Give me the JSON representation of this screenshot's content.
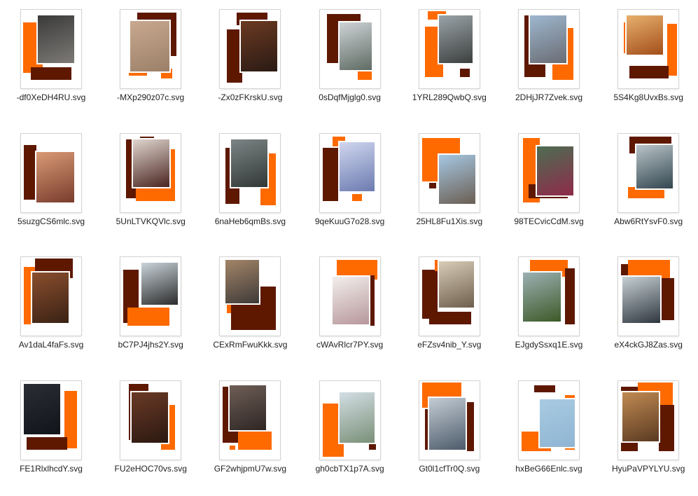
{
  "colors": {
    "orange": "#fe6a00",
    "maroon": "#5e1800",
    "label": "#222222"
  },
  "files": [
    {
      "name": "-df0XeDH4RU.svg",
      "layout": 0,
      "photo": [
        "#3a3a3a",
        "#7d7a76"
      ]
    },
    {
      "name": "-MXp290z07c.svg",
      "layout": 1,
      "photo": [
        "#c8a98f",
        "#9b7f68"
      ]
    },
    {
      "name": "-Zx0zFKrskU.svg",
      "layout": 2,
      "photo": [
        "#6b3a22",
        "#2a1a14"
      ]
    },
    {
      "name": "0sDqfMjglg0.svg",
      "layout": 3,
      "photo": [
        "#cdd3d6",
        "#5f6b63"
      ]
    },
    {
      "name": "1YRL289QwbQ.svg",
      "layout": 4,
      "photo": [
        "#9aa4a8",
        "#3c3f3e"
      ]
    },
    {
      "name": "2DHjJR7Zvek.svg",
      "layout": 5,
      "photo": [
        "#9eb7cf",
        "#6a6c73"
      ]
    },
    {
      "name": "5S4Kg8UvxBs.svg",
      "layout": 6,
      "photo": [
        "#e7b06d",
        "#a34e1a"
      ]
    },
    {
      "name": "5suzgCS6mlc.svg",
      "layout": 7,
      "photo": [
        "#d89a74",
        "#7a3c2d"
      ]
    },
    {
      "name": "5UnLTVKQVlc.svg",
      "layout": 8,
      "photo": [
        "#e0d6cf",
        "#4a2420"
      ]
    },
    {
      "name": "6naHeb6qmBs.svg",
      "layout": 9,
      "photo": [
        "#7c8585",
        "#313737"
      ]
    },
    {
      "name": "9qeKuuG7o28.svg",
      "layout": 10,
      "photo": [
        "#cfd6ee",
        "#6c7bb0"
      ]
    },
    {
      "name": "25HL8Fu1Xis.svg",
      "layout": 11,
      "photo": [
        "#a5c7e2",
        "#6b5e52"
      ]
    },
    {
      "name": "98TECvicCdM.svg",
      "layout": 12,
      "photo": [
        "#4c6d52",
        "#8f2b4a"
      ]
    },
    {
      "name": "Abw6RtYsvF0.svg",
      "layout": 13,
      "photo": [
        "#b9c4c9",
        "#33464f"
      ]
    },
    {
      "name": "Av1daL4faFs.svg",
      "layout": 14,
      "photo": [
        "#8a4e2e",
        "#3a2214"
      ]
    },
    {
      "name": "bC7PJ4jhs2Y.svg",
      "layout": 15,
      "photo": [
        "#c9d4d9",
        "#2b2b2b"
      ]
    },
    {
      "name": "CExRmFwuKkk.svg",
      "layout": 16,
      "photo": [
        "#a38568",
        "#3f3a38"
      ]
    },
    {
      "name": "cWAvRlcr7PY.svg",
      "layout": 17,
      "photo": [
        "#f2eeec",
        "#b7979b"
      ]
    },
    {
      "name": "eFZsv4nib_Y.svg",
      "layout": 18,
      "photo": [
        "#d8cdb8",
        "#6e5e4c"
      ]
    },
    {
      "name": "EJgdySsxq1E.svg",
      "layout": 19,
      "photo": [
        "#9bb0b2",
        "#3d5a28"
      ]
    },
    {
      "name": "eX4ckGJ8Zas.svg",
      "layout": 20,
      "photo": [
        "#c7d1d4",
        "#2f3640"
      ]
    },
    {
      "name": "FE1RlxlhcdY.svg",
      "layout": 21,
      "photo": [
        "#2a2d33",
        "#11151a"
      ]
    },
    {
      "name": "FU2eHOC70vs.svg",
      "layout": 22,
      "photo": [
        "#6a3a26",
        "#2b1811"
      ]
    },
    {
      "name": "GF2whjpmU7w.svg",
      "layout": 23,
      "photo": [
        "#6e5e56",
        "#2e2624"
      ]
    },
    {
      "name": "gh0cbTX1p7A.svg",
      "layout": 24,
      "photo": [
        "#d3dee4",
        "#7a9078"
      ]
    },
    {
      "name": "Gt0l1cfTr0Q.svg",
      "layout": 25,
      "photo": [
        "#c3ccd4",
        "#4d5b6a"
      ]
    },
    {
      "name": "hxBeG66Enlc.svg",
      "layout": 26,
      "photo": [
        "#a9cbe2",
        "#8fb5d3"
      ]
    },
    {
      "name": "HyuPaVPYLYU.svg",
      "layout": 27,
      "photo": [
        "#c08a52",
        "#5a3a22"
      ]
    }
  ]
}
